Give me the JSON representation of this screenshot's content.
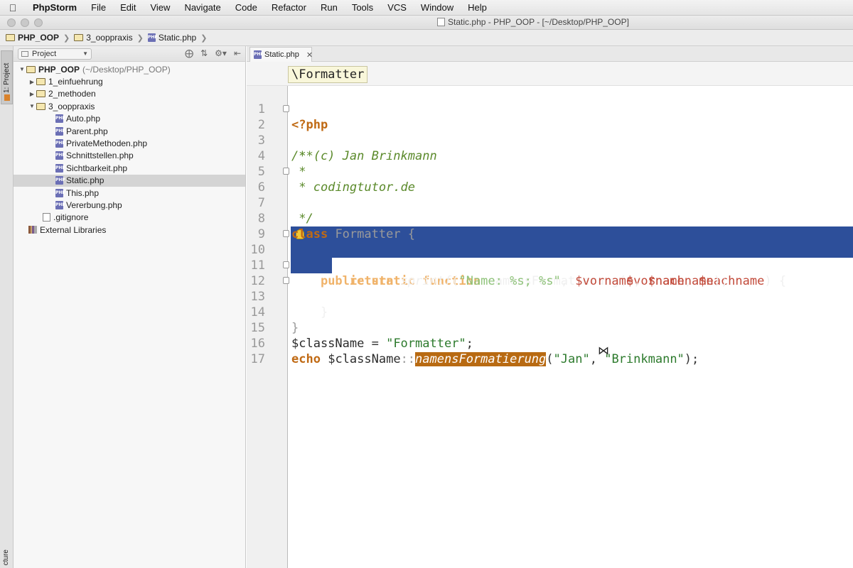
{
  "menubar": {
    "app": "PhpStorm",
    "items": [
      "File",
      "Edit",
      "View",
      "Navigate",
      "Code",
      "Refactor",
      "Run",
      "Tools",
      "VCS",
      "Window",
      "Help"
    ]
  },
  "window": {
    "title": "Static.php - PHP_OOP - [~/Desktop/PHP_OOP]"
  },
  "navbar": {
    "crumbs": [
      "PHP_OOP",
      "3_ooppraxis",
      "Static.php"
    ]
  },
  "toolstripe": {
    "project_label": "1: Project",
    "structure_label": "cture"
  },
  "project_panel": {
    "view_selector": "Project",
    "tree": [
      {
        "label": "PHP_OOP",
        "extra": "(~/Desktop/PHP_OOP)",
        "type": "folder",
        "depth": 0,
        "expanded": true
      },
      {
        "label": "1_einfuehrung",
        "type": "folder",
        "depth": 1,
        "expanded": false
      },
      {
        "label": "2_methoden",
        "type": "folder",
        "depth": 1,
        "expanded": false
      },
      {
        "label": "3_ooppraxis",
        "type": "folder",
        "depth": 1,
        "expanded": true
      },
      {
        "label": "Auto.php",
        "type": "php",
        "depth": 2
      },
      {
        "label": "Parent.php",
        "type": "php",
        "depth": 2
      },
      {
        "label": "PrivateMethoden.php",
        "type": "php",
        "depth": 2
      },
      {
        "label": "Schnittstellen.php",
        "type": "php",
        "depth": 2
      },
      {
        "label": "Sichtbarkeit.php",
        "type": "php",
        "depth": 2
      },
      {
        "label": "Static.php",
        "type": "php",
        "depth": 2,
        "selected": true
      },
      {
        "label": "This.php",
        "type": "php",
        "depth": 2
      },
      {
        "label": "Vererbung.php",
        "type": "php",
        "depth": 2
      },
      {
        "label": ".gitignore",
        "type": "file",
        "depth": 1
      },
      {
        "label": "External Libraries",
        "type": "lib",
        "depth": 0
      }
    ]
  },
  "editor": {
    "tab_label": "Static.php",
    "class_crumb": "\\Formatter",
    "line_numbers": [
      "1",
      "2",
      "3",
      "4",
      "5",
      "6",
      "7",
      "8",
      "9",
      "10",
      "11",
      "12",
      "13",
      "14",
      "15",
      "16",
      "17"
    ]
  }
}
